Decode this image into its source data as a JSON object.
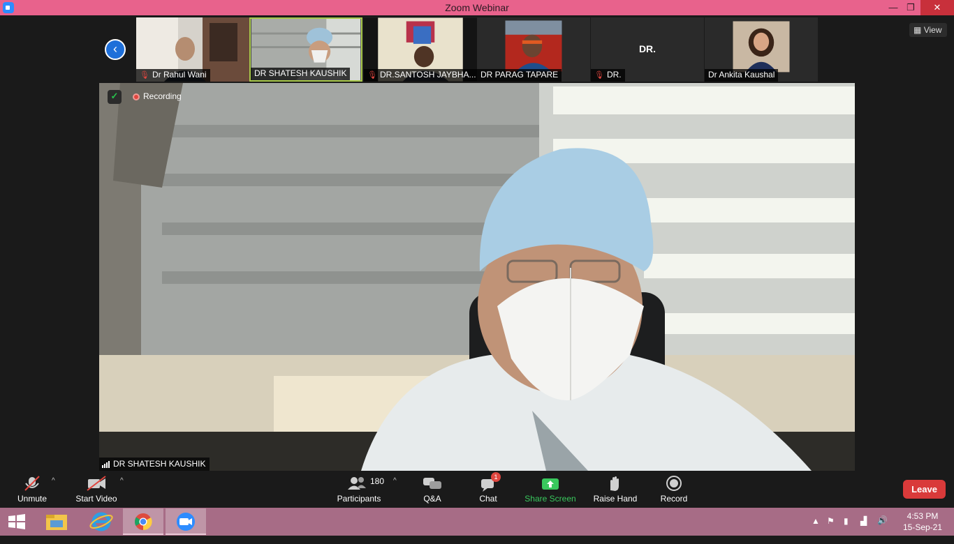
{
  "window": {
    "title": "Zoom Webinar",
    "min_glyph": "—",
    "max_glyph": "❐",
    "close_glyph": "✕"
  },
  "thumbnails": [
    {
      "name": "Dr Rahul Wani",
      "muted": true,
      "video": true,
      "active": false
    },
    {
      "name": "DR SHATESH KAUSHIK",
      "muted": false,
      "video": true,
      "active": true
    },
    {
      "name": "DR.SANTOSH JAYBHA...",
      "muted": true,
      "video": true,
      "active": false
    },
    {
      "name": "DR PARAG TAPARE",
      "muted": false,
      "video": true,
      "active": false
    },
    {
      "name": "DR.",
      "muted": true,
      "video": false,
      "display_text": "DR.",
      "active": false
    },
    {
      "name": "Dr Ankita Kaushal",
      "muted": false,
      "video": true,
      "active": false
    }
  ],
  "view_button": {
    "label": "View",
    "icon": "grid-icon"
  },
  "main_video": {
    "recording_label": "Recording",
    "speaker_name": "DR SHATESH KAUSHIK",
    "shield_icon": "encryption-shield-icon"
  },
  "toolbar": {
    "unmute": {
      "label": "Unmute",
      "icon": "microphone-muted-icon"
    },
    "start_video": {
      "label": "Start Video",
      "icon": "video-camera-off-icon"
    },
    "participants": {
      "label": "Participants",
      "count": "180",
      "icon": "participants-icon"
    },
    "qa": {
      "label": "Q&A",
      "icon": "qa-icon"
    },
    "chat": {
      "label": "Chat",
      "badge": "1",
      "icon": "chat-icon"
    },
    "share_screen": {
      "label": "Share Screen",
      "icon": "share-screen-icon",
      "color": "#39c85d"
    },
    "raise_hand": {
      "label": "Raise Hand",
      "icon": "hand-icon"
    },
    "record": {
      "label": "Record",
      "icon": "record-icon"
    },
    "leave": {
      "label": "Leave",
      "color": "#d93a3a"
    }
  },
  "taskbar": {
    "apps": [
      "file-explorer-icon",
      "internet-explorer-icon",
      "chrome-icon",
      "zoom-icon"
    ],
    "active_app": "chrome-icon",
    "time": "4:53 PM",
    "date": "15-Sep-21"
  },
  "colors": {
    "title_bar": "#e8628c",
    "taskbar": "#a76c86",
    "meeting_bg": "#1a1a1a",
    "active_speaker_border": "#a8c84a"
  }
}
